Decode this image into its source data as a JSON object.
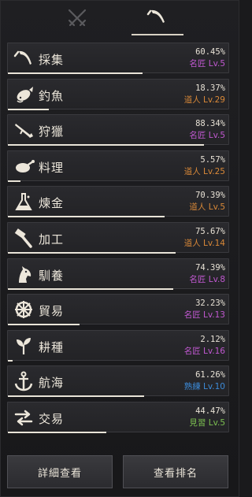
{
  "tabs": [
    {
      "icon": "crossed-swords-icon",
      "active": false
    },
    {
      "icon": "sickle-icon",
      "active": true
    }
  ],
  "skills": [
    {
      "name": "採集",
      "icon": "sickle-icon",
      "percent": "60.45%",
      "rank": "名匠 Lv.5",
      "rank_color": "#c058d0",
      "progress": 0.6045
    },
    {
      "name": "釣魚",
      "icon": "fish-icon",
      "percent": "18.37%",
      "rank": "道人 Lv.29",
      "rank_color": "#d88838",
      "progress": 0.1837
    },
    {
      "name": "狩獵",
      "icon": "rifle-icon",
      "percent": "88.34%",
      "rank": "名匠 Lv.5",
      "rank_color": "#c058d0",
      "progress": 0.8834
    },
    {
      "name": "料理",
      "icon": "roast-chicken-icon",
      "percent": "5.57%",
      "rank": "道人 Lv.25",
      "rank_color": "#d88838",
      "progress": 0.0557
    },
    {
      "name": "煉金",
      "icon": "flask-icon",
      "percent": "70.39%",
      "rank": "道人 Lv.5",
      "rank_color": "#d88838",
      "progress": 0.7039
    },
    {
      "name": "加工",
      "icon": "hammer-icon",
      "percent": "75.67%",
      "rank": "道人 Lv.14",
      "rank_color": "#d88838",
      "progress": 0.7567
    },
    {
      "name": "馴養",
      "icon": "horse-head-icon",
      "percent": "74.39%",
      "rank": "名匠 Lv.8",
      "rank_color": "#c058d0",
      "progress": 0.7439
    },
    {
      "name": "貿易",
      "icon": "ship-wheel-icon",
      "percent": "32.23%",
      "rank": "名匠 Lv.13",
      "rank_color": "#c058d0",
      "progress": 0.3223
    },
    {
      "name": "耕種",
      "icon": "sprout-icon",
      "percent": "2.12%",
      "rank": "名匠 Lv.16",
      "rank_color": "#c058d0",
      "progress": 0.0212
    },
    {
      "name": "航海",
      "icon": "anchor-icon",
      "percent": "61.26%",
      "rank": "熟練 Lv.10",
      "rank_color": "#3c8ad8",
      "progress": 0.6126
    },
    {
      "name": "交易",
      "icon": "exchange-arrows-icon",
      "percent": "44.47%",
      "rank": "見習 Lv.5",
      "rank_color": "#7cc050",
      "progress": 0.4447
    }
  ],
  "buttons": {
    "details": "詳細查看",
    "ranking": "查看排名"
  }
}
